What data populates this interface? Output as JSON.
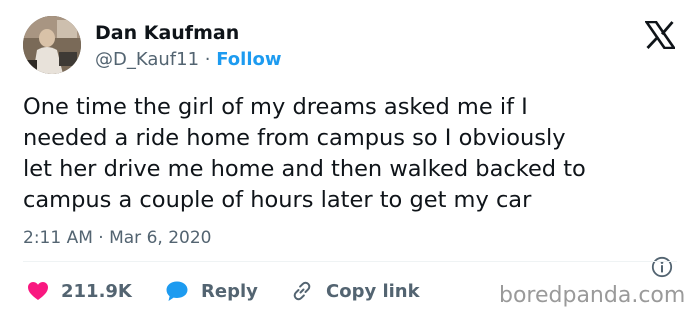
{
  "author": {
    "name": "Dan Kaufman",
    "handle": "@D_Kauf11",
    "separator": "·",
    "follow_label": "Follow"
  },
  "tweet": {
    "lines": [
      "One time the girl of my dreams asked me if I",
      "needed a ride home from campus so I obviously",
      "let her drive me home and then walked backed to",
      "campus a couple of hours later to get my car"
    ],
    "timestamp": "2:11 AM · Mar 6, 2020"
  },
  "actions": {
    "likes_count": "211.9K",
    "reply_label": "Reply",
    "copy_link_label": "Copy link"
  },
  "icons": {
    "platform": "x-logo-icon",
    "info": "info-icon",
    "like": "heart-icon",
    "reply": "speech-bubble-icon",
    "copy": "link-icon"
  },
  "colors": {
    "text": "#0f1419",
    "secondary": "#536471",
    "follow": "#1d9bf0",
    "heart": "#f91880",
    "reply_bubble": "#1d9bf0"
  },
  "watermark": "boredpanda.com"
}
